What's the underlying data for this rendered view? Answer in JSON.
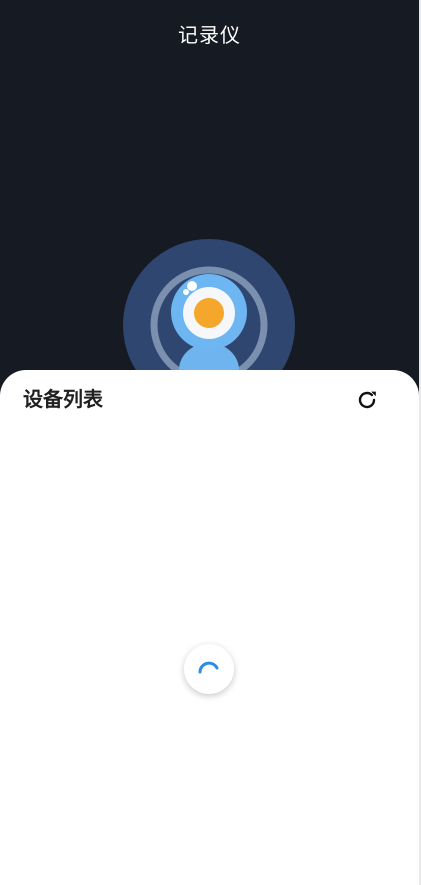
{
  "app": {
    "title": "记录仪"
  },
  "device_list": {
    "title": "设备列表",
    "refresh_icon": "refresh-icon",
    "state": "loading"
  },
  "icons": {
    "illustration": "camera-device-icon",
    "spinner": "loading-spinner-icon"
  },
  "colors": {
    "background": "#161a22",
    "panel": "#ffffff",
    "accent": "#2b8de6",
    "orange": "#f5a72c"
  }
}
